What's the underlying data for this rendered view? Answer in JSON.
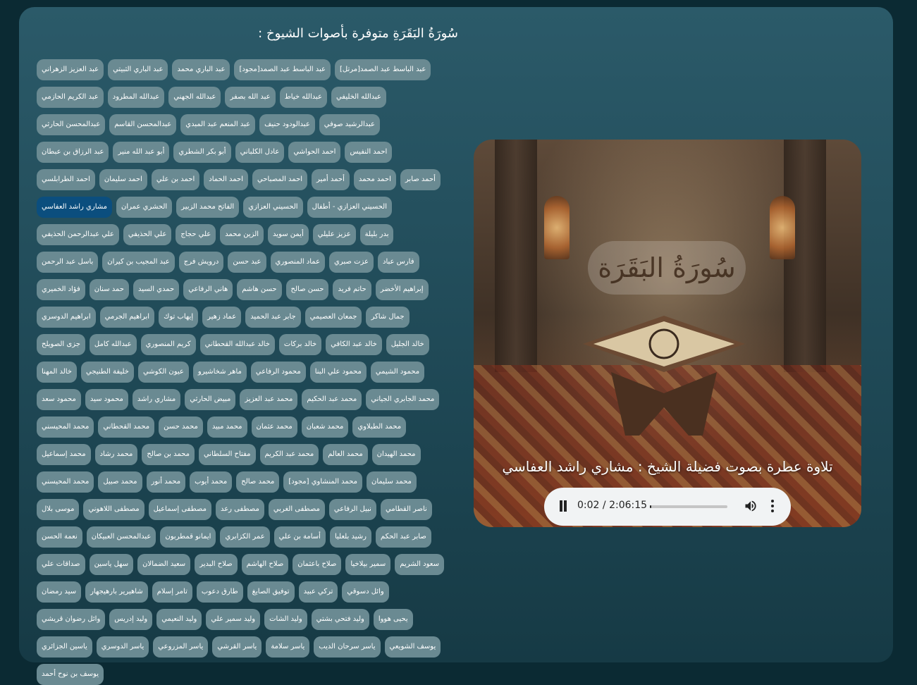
{
  "page": {
    "title": "سُورَةُ البَقَرَةِ متوفرة بأصوات الشيوخ :"
  },
  "reciters": [
    "عبد العزيز الزهراني",
    "عبد الباري الثبيتي",
    "عبد الباري محمد",
    "عبد الباسط عبد الصمد[مجود]",
    "عبد الباسط عبد الصمد[مرتل]",
    "عبد الكريم الحازمي",
    "عبدالله المطرود",
    "عبدالله الجهني",
    "عبد الله بصفر",
    "عبدالله خياط",
    "عبدالله الخليفي",
    "عبدالمحسن الحارثي",
    "عبدالمحسن القاسم",
    "عبد المنعم عبد المبدي",
    "عبدالودود حنيف",
    "عبدالرشيد صوفي",
    "عبد الرزاق بن عبطان",
    "أبو عبد الله منير",
    "أبو بكر الشطري",
    "عادل الكلباني",
    "احمد الحواشي",
    "احمد النفيس",
    "احمد الطرابلسي",
    "احمد سليمان",
    "احمد بن علي",
    "احمد الحماد",
    "احمد المصباحي",
    "أحمد أمير",
    "احمد محمد",
    "أحمد صابر",
    "مشاري راشد العفاسي",
    "الحشري عمران",
    "الفاتح محمد الزبير",
    "الحسيني العزازي",
    "الحسيني العزازي - أطفال",
    "علي عبدالرحمن الحذيفي",
    "علي الحذيفي",
    "علي حجاج",
    "الزين محمد",
    "أيمن سويد",
    "عزيز عليلي",
    "بدر بليلة",
    "باسل عبد الرحمن",
    "عبد المجيب بن كيران",
    "درويش فرج",
    "عبد حسن",
    "عماد المنصوري",
    "عزت صبري",
    "فارس عباد",
    "فؤاد الخميري",
    "حمد سنان",
    "حمدي السيد",
    "هاني الرفاعي",
    "حسن هاشم",
    "حسن صالح",
    "حاتم فريد",
    "إبراهيم الأخضر",
    "ابراهيم الدوسري",
    "ابراهيم الجرمي",
    "إيهاب توك",
    "عماد زهير",
    "جابر عبد الحميد",
    "جمعان العصيمي",
    "جمال شاكر",
    "جزى الصويلح",
    "عبدالله كامل",
    "كريم المنصوري",
    "خالد عبدالله القحطاني",
    "خالد بركات",
    "خالد عبد الكافي",
    "خالد الجليل",
    "خالد المهنا",
    "خليفة الطنيجي",
    "عيون الكوشي",
    "ماهر شخاشيرو",
    "محمود الرفاعي",
    "محمود علي البنا",
    "محمود الشيمي",
    "محمود سعد",
    "محمود سيد",
    "مشاري راشد",
    "مبيض الحارثي",
    "محمد عبد العزيز",
    "محمد عبد الحكيم",
    "محمد الجابري الجياني",
    "محمد المحيسني",
    "محمد القحطاني",
    "محمد حسن",
    "محمد مبيد",
    "محمد عثمان",
    "محمد شعبان",
    "محمد الطبلاوي",
    "محمد إسماعيل",
    "محمد رشاد",
    "محمد بن صالح",
    "مفتاح السلطاني",
    "محمد عبد الكريم",
    "محمد العالم",
    "محمد الهيدان",
    "محمد المحيسني",
    "محمد صبيل",
    "محمد أنور",
    "محمد أيوب",
    "محمد صالح",
    "محمد المنشاوي [مجود]",
    "محمد سليمان",
    "موسى بلال",
    "مصطفى اللاهوني",
    "مصطفى إسماعيل",
    "مصطفى رعد",
    "مصطفى الغربي",
    "نبيل الرفاعي",
    "ناصر القطامي",
    "نعمة الحسن",
    "عبدالمحسن العبيكان",
    "ايمانو قمطربون",
    "عمر الكزابري",
    "أسامة بن علي",
    "رشيد بلعليا",
    "صابر عبد الحكم",
    "صداقات علي",
    "سهل ياسين",
    "سعيد الضمالان",
    "صلاح البدير",
    "صلاح الهاشم",
    "صلاح باعثمان",
    "سمير بيلاخيا",
    "سعود الشريم",
    "سيد رمضان",
    "شاهيرير بارهيجهار",
    "تامر إسلام",
    "طارق دعوب",
    "توفيق الصايغ",
    "تركي عبيد",
    "وائل دسوقي",
    "وائل رضوان قريشي",
    "وليد إدريس",
    "وليد النعيمي",
    "وليد سمير علي",
    "وليد الشات",
    "وليد فتحي بشتي",
    "يحيى هووا",
    "ياسين الجزائري",
    "ياسر الدوسري",
    "ياسر المزروعي",
    "ياسر القرشي",
    "ياسر سلامة",
    "ياسر سرحان الديب",
    "يوسف الشويعي",
    "يوسف بن نوح أحمد"
  ],
  "active_reciter": "مشاري راشد العفاسي",
  "player": {
    "cover_calligraphy": "سُورَةُ البَقَرَة",
    "recitation_label": "تلاوة عطرة بصوت فضيلة الشيخ : مشاري راشد العفاسي",
    "current_time": "0:02",
    "separator": " / ",
    "duration": "2:06:15",
    "progress_fraction": 0.02,
    "pause_icon": "pause-icon",
    "volume_icon": "volume-icon",
    "more_icon": "more-vert-icon"
  },
  "colors": {
    "chip": "#6a8a92",
    "chip_active": "#0b4e7e",
    "panel": "#2b5a69",
    "background": "#0b2a33"
  }
}
